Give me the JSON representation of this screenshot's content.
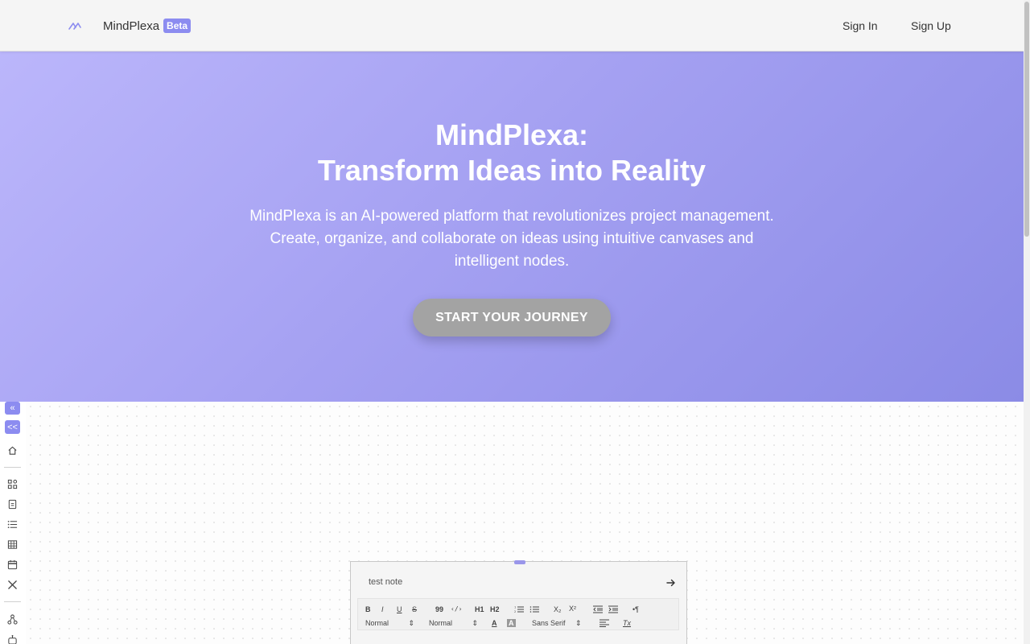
{
  "header": {
    "brand_name": "MindPlexa",
    "beta_badge": "Beta",
    "sign_in": "Sign In",
    "sign_up": "Sign Up"
  },
  "hero": {
    "title_line1": "MindPlexa:",
    "title_line2": "Transform Ideas into Reality",
    "description": "MindPlexa is an AI-powered platform that revolutionizes project management. Create, organize, and collaborate on ideas using intuitive canvases and intelligent nodes.",
    "cta_label": "START YOUR JOURNEY"
  },
  "sidebar": {
    "collapse_label": "«",
    "collapse2_label": "<<",
    "icons": [
      "home-icon",
      "grid-icon",
      "document-icon",
      "list-icon",
      "table-icon",
      "calendar-icon",
      "tools-icon",
      "hierarchy-icon",
      "bot-icon"
    ]
  },
  "note": {
    "title": "test note",
    "toolbar": {
      "bold": "B",
      "italic": "I",
      "underline": "U",
      "strike": "S",
      "quote": "99",
      "code": "‹/›",
      "h1": "H1",
      "h2": "H2",
      "subscript": "X₂",
      "superscript": "X²",
      "rtl": "•¶",
      "header_select": "Normal",
      "size_select": "Normal",
      "font_select": "Sans Serif",
      "color": "A",
      "background": "A",
      "clean": "Tx"
    }
  },
  "colors": {
    "accent": "#8c8cf0",
    "hero_start": "#bbb6fb",
    "hero_end": "#8b8be6",
    "cta_bg": "#a3a3a3"
  }
}
